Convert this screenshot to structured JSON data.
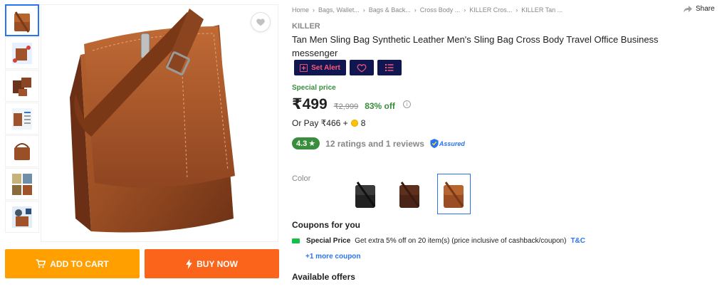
{
  "gallery": {
    "thumbnail_count": 7,
    "wishlist_icon": "heart-icon"
  },
  "actions": {
    "add_to_cart": "ADD TO CART",
    "buy_now": "BUY NOW",
    "cart_icon": "cart-icon",
    "bolt_icon": "lightning-icon"
  },
  "breadcrumbs": [
    "Home",
    "Bags, Wallet...",
    "Bags & Back...",
    "Cross Body ...",
    "KILLER Cros...",
    "KILLER Tan ..."
  ],
  "share_label": "Share",
  "product": {
    "brand": "KILLER",
    "title": "Tan Men Sling Bag Synthetic Leather Men's Sling Bag Cross Body Travel Office Business messenger"
  },
  "chips": {
    "set_alert": "Set Alert"
  },
  "pricing": {
    "special_label": "Special price",
    "price": "₹499",
    "mrp": "₹2,999",
    "discount": "83% off",
    "or_pay_text": "Or Pay ₹466 +",
    "coins": "8"
  },
  "rating": {
    "value": "4.3",
    "star": "★",
    "counts": "12 ratings and 1 reviews",
    "assured": "Assured"
  },
  "color": {
    "label": "Color",
    "options": [
      "black",
      "dark-brown",
      "tan"
    ],
    "selected": "tan"
  },
  "coupons": {
    "heading": "Coupons for you",
    "title": "Special Price",
    "text": "Get extra 5% off on 20 item(s) (price inclusive of cashback/coupon)",
    "tnc": "T&C",
    "more": "+1 more coupon"
  },
  "offers_heading": "Available offers",
  "colors": {
    "cart": "#ff9f00",
    "buy": "#fb641b",
    "navy": "#0f1650",
    "green": "#388e3c",
    "blue": "#2874f0",
    "tan_leather": "#a0532a"
  }
}
